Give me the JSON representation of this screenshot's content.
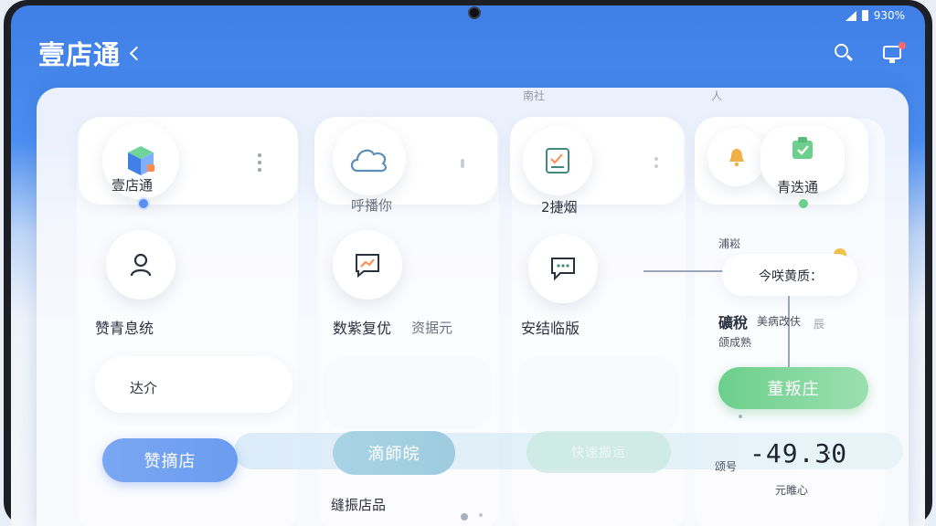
{
  "status": {
    "battery": "930%"
  },
  "header": {
    "title": "壹店通"
  },
  "faint_top": {
    "left": "南社",
    "right": "人"
  },
  "col1": {
    "app_label": "壹店通",
    "item2_label": "赞青息统",
    "item3_label": "达介",
    "button": "赞摘店"
  },
  "col2": {
    "item1_label": "呼播你",
    "item2_label": "数紫复优",
    "item2_side": "资据元",
    "button": "滴師皖",
    "item4_label": "缝振店品"
  },
  "col3": {
    "item1_label": "2捷烟",
    "item2_label": "安结临版",
    "button": "快速搬运"
  },
  "col4": {
    "app_label": "青迭通",
    "tag_label": "浦崧",
    "info_label": "今咲黄质：",
    "row_title": "礦稅",
    "row_side": "美病改伕",
    "row_side_small": "辰",
    "sub_label": "颌成熟",
    "button": "董叛庄",
    "price_label": "颂号",
    "price": "-49.30",
    "price_suffix": ":",
    "footer_label": "元睢心"
  },
  "colors": {
    "accent_blue": "#4b8df0",
    "green": "#6ccf8c"
  }
}
